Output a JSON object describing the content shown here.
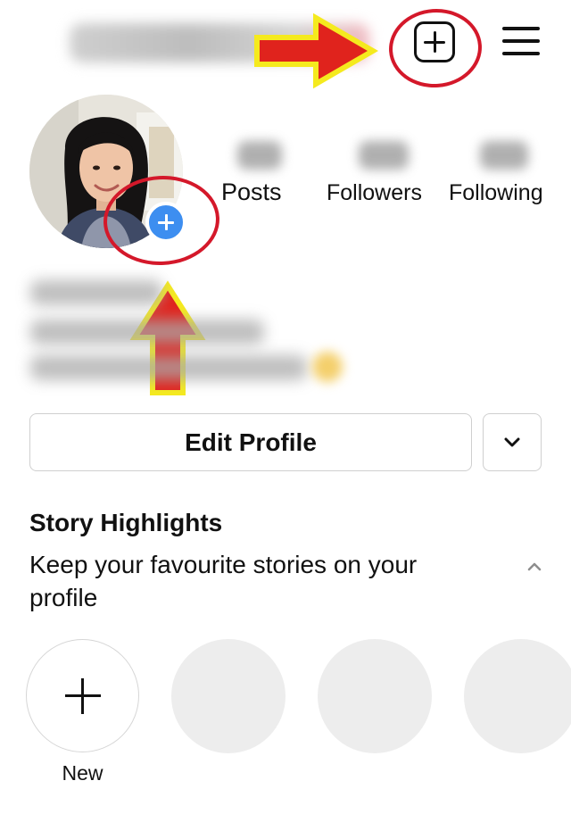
{
  "header": {
    "username": "",
    "create_icon": "plus-square-icon",
    "menu_icon": "hamburger-menu-icon"
  },
  "profile": {
    "avatar_icon": "profile-photo",
    "add_story_icon": "plus-circle-icon",
    "stats": [
      {
        "label": "Posts"
      },
      {
        "label": "Followers"
      },
      {
        "label": "Following"
      }
    ]
  },
  "actions": {
    "edit_profile_label": "Edit Profile",
    "more_icon": "chevron-down-icon"
  },
  "highlights": {
    "title": "Story Highlights",
    "subtitle": "Keep your favourite stories on your profile",
    "collapse_icon": "chevron-up-icon",
    "new_label": "New"
  },
  "annotations": {
    "ring_color": "#d4182a",
    "arrow_fill": "#e0231d",
    "arrow_outline": "#f5ea1e"
  },
  "colors": {
    "accent": "#3d8ef0",
    "text": "#111111",
    "border": "#cfcfcf",
    "placeholder": "#ededed"
  }
}
